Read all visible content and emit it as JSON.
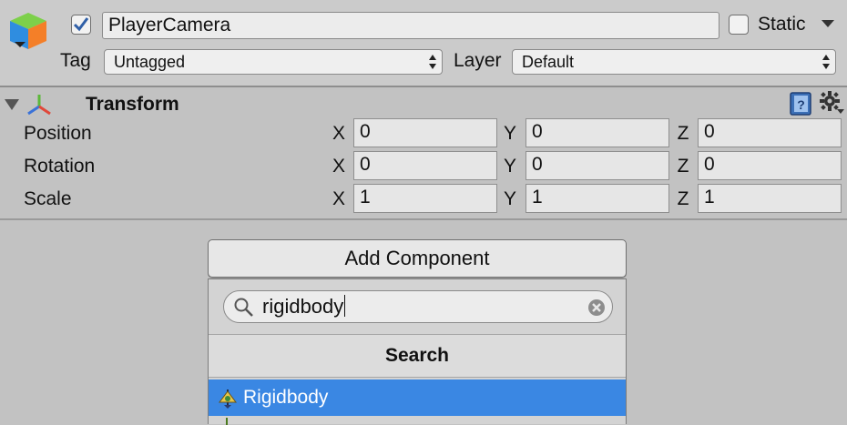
{
  "header": {
    "object_name": "PlayerCamera",
    "static_label": "Static",
    "tag_label": "Tag",
    "tag_value": "Untagged",
    "layer_label": "Layer",
    "layer_value": "Default",
    "active_checked": true,
    "static_checked": false
  },
  "transform": {
    "title": "Transform",
    "rows": [
      {
        "label": "Position",
        "x": "0",
        "y": "0",
        "z": "0"
      },
      {
        "label": "Rotation",
        "x": "0",
        "y": "0",
        "z": "0"
      },
      {
        "label": "Scale",
        "x": "1",
        "y": "1",
        "z": "1"
      }
    ],
    "axis_labels": {
      "x": "X",
      "y": "Y",
      "z": "Z"
    }
  },
  "add_component": {
    "button_label": "Add Component",
    "search_value": "rigidbody",
    "search_header": "Search",
    "results": [
      {
        "label": "Rigidbody",
        "selected": true
      }
    ]
  },
  "colors": {
    "selection": "#3a87e3",
    "checkbox_blue": "#2f5fa7",
    "background": "#c2c2c2"
  },
  "icons": [
    "gameobject-cube-icon",
    "transform-axes-icon",
    "help-book-icon",
    "gear-icon",
    "search-icon",
    "clear-search-icon",
    "rigidbody-icon"
  ]
}
